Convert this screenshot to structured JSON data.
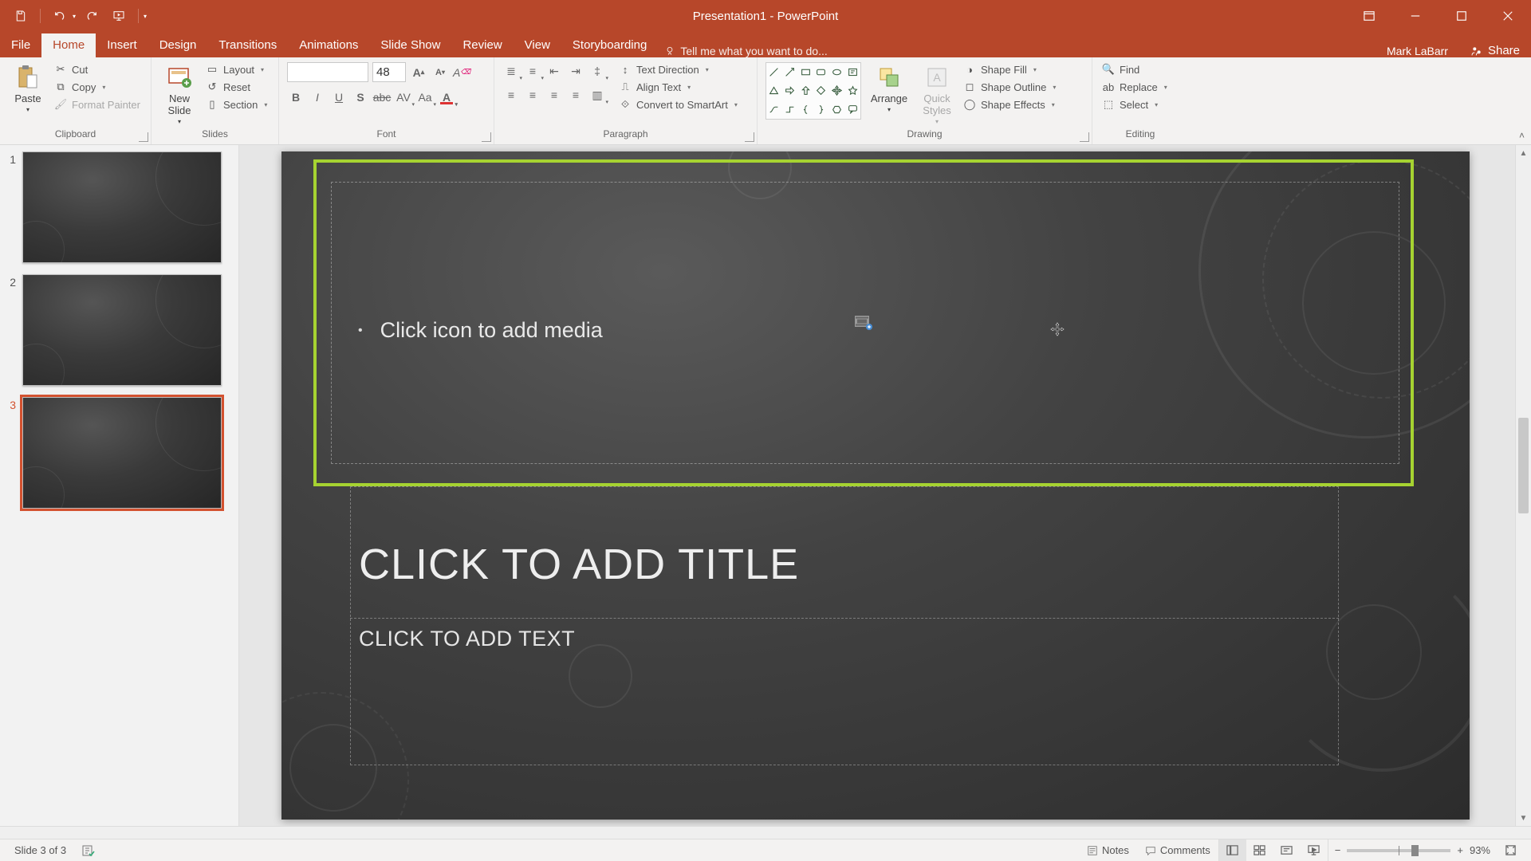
{
  "app": {
    "title": "Presentation1 - PowerPoint",
    "user": "Mark LaBarr",
    "share": "Share"
  },
  "qat": {
    "save": "save",
    "undo": "undo",
    "redo": "redo",
    "start": "start-from-beginning"
  },
  "tabs": {
    "file": "File",
    "home": "Home",
    "insert": "Insert",
    "design": "Design",
    "transitions": "Transitions",
    "animations": "Animations",
    "slideshow": "Slide Show",
    "review": "Review",
    "view": "View",
    "storyboarding": "Storyboarding",
    "tellme": "Tell me what you want to do..."
  },
  "ribbon": {
    "clipboard": {
      "label": "Clipboard",
      "paste": "Paste",
      "cut": "Cut",
      "copy": "Copy",
      "painter": "Format Painter"
    },
    "slides": {
      "label": "Slides",
      "newslide": "New\nSlide",
      "layout": "Layout",
      "reset": "Reset",
      "section": "Section"
    },
    "font": {
      "label": "Font",
      "size": "48"
    },
    "paragraph": {
      "label": "Paragraph",
      "textdir": "Text Direction",
      "align": "Align Text",
      "smartart": "Convert to SmartArt"
    },
    "drawing": {
      "label": "Drawing",
      "arrange": "Arrange",
      "quick": "Quick\nStyles",
      "fill": "Shape Fill",
      "outline": "Shape Outline",
      "effects": "Shape Effects"
    },
    "editing": {
      "label": "Editing",
      "find": "Find",
      "replace": "Replace",
      "select": "Select"
    }
  },
  "thumbs": {
    "n1": "1",
    "n2": "2",
    "n3": "3"
  },
  "slide": {
    "media_prompt": "Click icon to add media",
    "title_prompt": "CLICK TO ADD TITLE",
    "text_prompt": "CLICK TO ADD TEXT"
  },
  "status": {
    "slidecount": "Slide 3 of 3",
    "notes": "Notes",
    "comments": "Comments",
    "zoom": "93%"
  }
}
